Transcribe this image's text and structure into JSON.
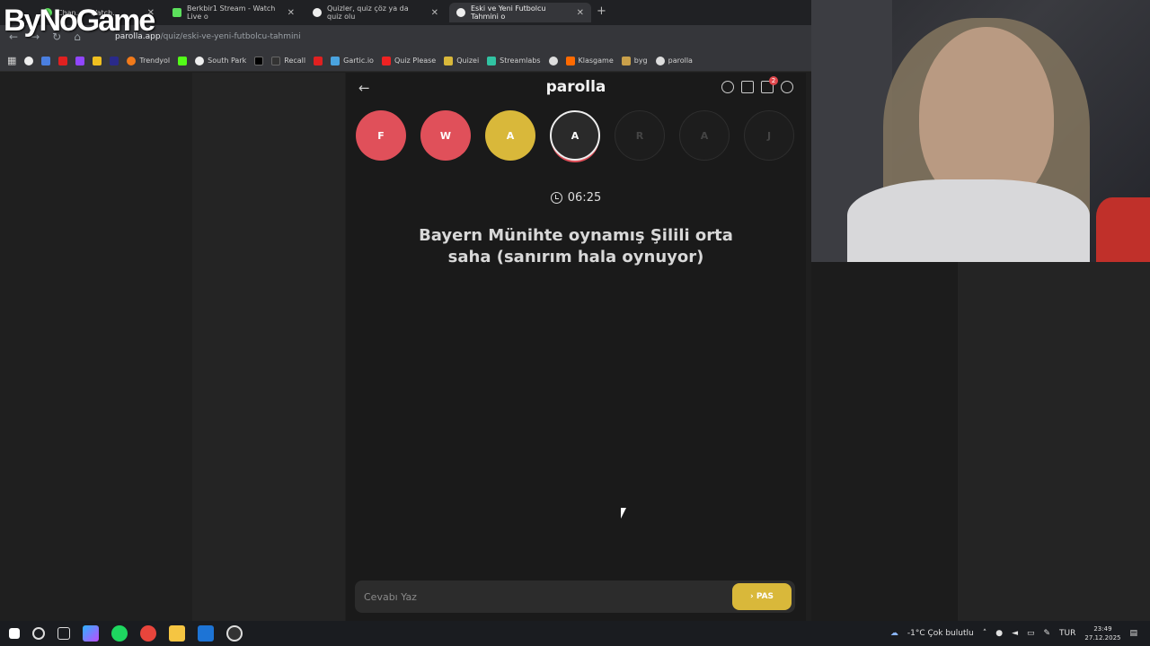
{
  "browser": {
    "tabs": [
      {
        "label": "Chan... - Watch..."
      },
      {
        "label": "Berkbir1 Stream - Watch Live o"
      },
      {
        "label": "Quizler, quiz çöz ya da quiz olu"
      },
      {
        "label": "Eski ve Yeni Futbolcu Tahmini o"
      }
    ],
    "url_host": "parolla.app",
    "url_path": "/quiz/eski-ve-yeni-futbolcu-tahmini",
    "bookmarks": [
      {
        "label": "Trendyol",
        "color": "#f27a1a"
      },
      {
        "label": "South Park",
        "color": "#ffffff"
      },
      {
        "label": "Recall",
        "color": "#333333"
      },
      {
        "label": "Gartic.io",
        "color": "#4aa3df"
      },
      {
        "label": "Quiz Please",
        "color": "#e22"
      },
      {
        "label": "Quizei",
        "color": "#d9b83a"
      },
      {
        "label": "Streamlabs",
        "color": "#31c3a2"
      },
      {
        "label": "Klasgame",
        "color": "#ff6a00"
      },
      {
        "label": "byg",
        "color": "#c9a04a"
      },
      {
        "label": "parolla",
        "color": "#dddddd"
      }
    ]
  },
  "overlay": {
    "logo": "ByNoGame"
  },
  "app": {
    "title": "parolla",
    "notification_count": "2",
    "letters": [
      {
        "letter": "F",
        "state": "wrong"
      },
      {
        "letter": "W",
        "state": "wrong"
      },
      {
        "letter": "A",
        "state": "passed"
      },
      {
        "letter": "A",
        "state": "current"
      },
      {
        "letter": "R",
        "state": "pending"
      },
      {
        "letter": "A",
        "state": "pending"
      },
      {
        "letter": "J",
        "state": "pending"
      }
    ],
    "timer": "06:25",
    "question": "Bayern Münihte oynamış Şilili orta saha (sanırım hala oynuyor)",
    "answer_placeholder": "Cevabı Yaz",
    "pass_label": "PAS"
  },
  "taskbar": {
    "weather": "-1°C  Çok bulutlu",
    "language": "TUR",
    "time": "23:49",
    "date": "27.12.2025"
  }
}
